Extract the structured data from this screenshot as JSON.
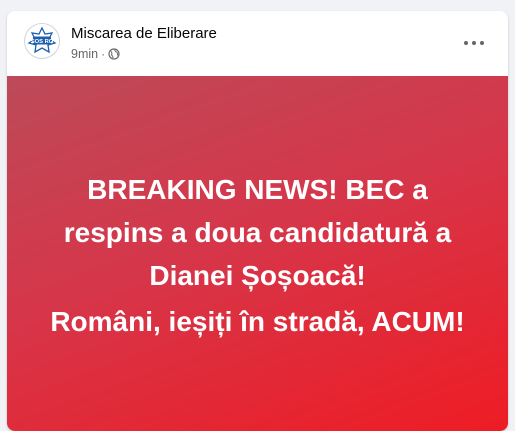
{
  "post": {
    "author": "Miscarea de Eliberare",
    "time": "9min",
    "separator": "·",
    "audience_icon": "globe-icon",
    "more_icon": "more-options-icon",
    "avatar_text": "SOS RO",
    "media": {
      "headline_line1": "BREAKING NEWS! BEC a",
      "headline_line2": "respins a doua candidatură a",
      "headline_line3": "Dianei Șoșoacă!",
      "subline": "Români, ieșiți în stradă, ACUM!",
      "gradient_start": "#bc4a58",
      "gradient_end": "#ee1c24",
      "text_color": "#ffffff"
    }
  }
}
